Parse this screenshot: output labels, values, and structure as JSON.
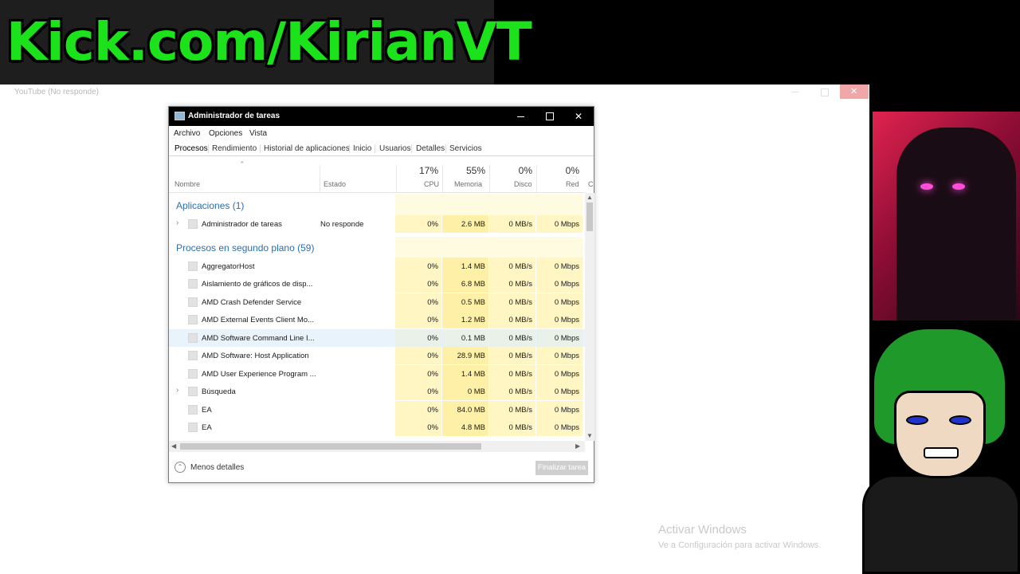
{
  "banner": {
    "text": "Kick.com/KirianVT"
  },
  "background_window": {
    "title": "YouTube (No responde)"
  },
  "activation": {
    "title": "Activar Windows",
    "subtitle": "Ve a Configuración para activar Windows."
  },
  "task_manager": {
    "title": "Administrador de tareas",
    "menu": [
      "Archivo",
      "Opciones",
      "Vista"
    ],
    "tabs": [
      "Procesos",
      "Rendimiento",
      "Historial de aplicaciones",
      "Inicio",
      "Usuarios",
      "Detalles",
      "Servicios"
    ],
    "active_tab": "Procesos",
    "columns": {
      "name": "Nombre",
      "status": "Estado",
      "cpu": {
        "pct": "17%",
        "label": "CPU"
      },
      "memory": {
        "pct": "55%",
        "label": "Memoria"
      },
      "disk": {
        "pct": "0%",
        "label": "Disco"
      },
      "network": {
        "pct": "0%",
        "label": "Red"
      },
      "next": "C"
    },
    "groups": {
      "apps": "Aplicaciones (1)",
      "background": "Procesos en segundo plano (59)"
    },
    "app_rows": [
      {
        "name": "Administrador de tareas",
        "status": "No responde",
        "cpu": "0%",
        "memory": "2.6 MB",
        "disk": "0 MB/s",
        "network": "0 Mbps"
      }
    ],
    "bg_rows": [
      {
        "name": "AggregatorHost",
        "cpu": "0%",
        "memory": "1.4 MB",
        "disk": "0 MB/s",
        "network": "0 Mbps"
      },
      {
        "name": "Aislamiento de gráficos de disp...",
        "cpu": "0%",
        "memory": "6.8 MB",
        "disk": "0 MB/s",
        "network": "0 Mbps"
      },
      {
        "name": "AMD Crash Defender Service",
        "cpu": "0%",
        "memory": "0.5 MB",
        "disk": "0 MB/s",
        "network": "0 Mbps"
      },
      {
        "name": "AMD External Events Client Mo...",
        "cpu": "0%",
        "memory": "1.2 MB",
        "disk": "0 MB/s",
        "network": "0 Mbps"
      },
      {
        "name": "AMD Software Command Line I...",
        "cpu": "0%",
        "memory": "0.1 MB",
        "disk": "0 MB/s",
        "network": "0 Mbps"
      },
      {
        "name": "AMD Software: Host Application",
        "cpu": "0%",
        "memory": "28.9 MB",
        "disk": "0 MB/s",
        "network": "0 Mbps"
      },
      {
        "name": "AMD User Experience Program ...",
        "cpu": "0%",
        "memory": "1.4 MB",
        "disk": "0 MB/s",
        "network": "0 Mbps"
      },
      {
        "name": "Búsqueda",
        "cpu": "0%",
        "memory": "0 MB",
        "disk": "0 MB/s",
        "network": "0 Mbps"
      },
      {
        "name": "EA",
        "cpu": "0%",
        "memory": "84.0 MB",
        "disk": "0 MB/s",
        "network": "0 Mbps"
      },
      {
        "name": "EA",
        "cpu": "0%",
        "memory": "4.8 MB",
        "disk": "0 MB/s",
        "network": "0 Mbps"
      }
    ],
    "footer": {
      "less_details": "Menos detalles",
      "end_task": "Finalizar tarea"
    }
  }
}
